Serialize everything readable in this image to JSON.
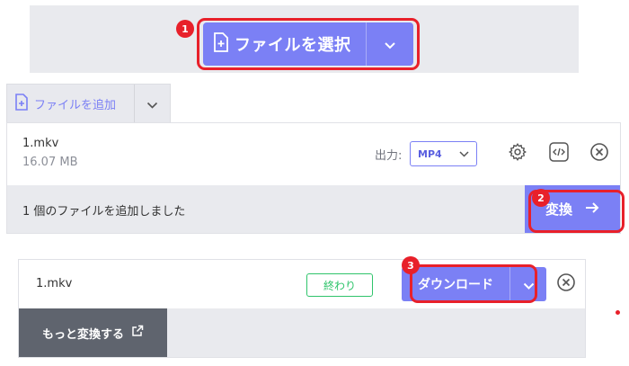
{
  "select_file": {
    "label": "ファイルを選択",
    "step": "1"
  },
  "add_file": {
    "label": "ファイルを追加"
  },
  "file": {
    "name": "1.mkv",
    "size": "16.07 MB",
    "output_label": "出力:",
    "format": "MP4"
  },
  "status": {
    "text": "1 個のファイルを追加しました"
  },
  "convert": {
    "label": "変換",
    "step": "2"
  },
  "result": {
    "name": "1.mkv",
    "status": "終わり"
  },
  "download": {
    "label": "ダウンロード",
    "step": "3"
  },
  "more": {
    "label": "もっと変換する"
  },
  "colors": {
    "accent": "#7b80f5",
    "annotation_red": "#e8202a",
    "done_green": "#2fc46b",
    "panel_gray": "#e9eaee",
    "dark_button": "#5f646e"
  }
}
